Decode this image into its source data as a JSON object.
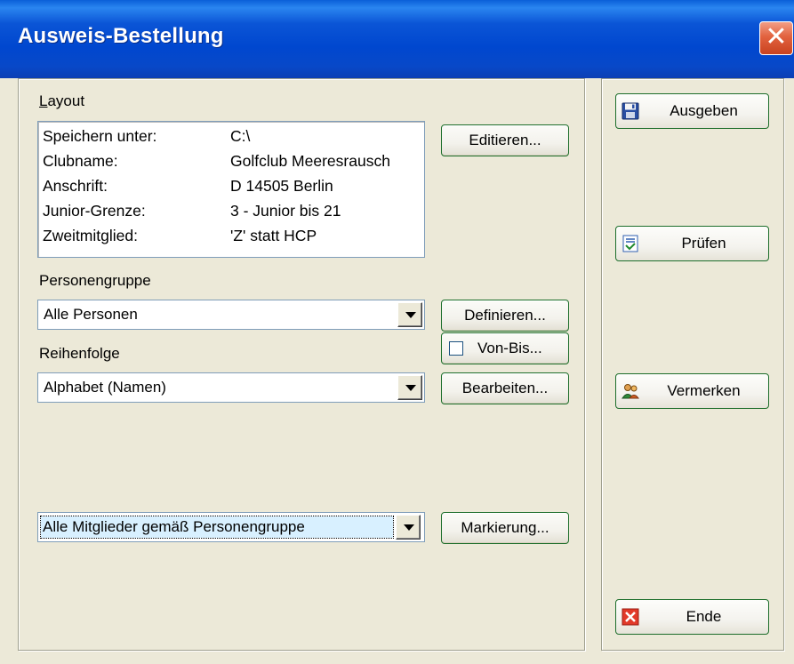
{
  "window": {
    "title": "Ausweis-Bestellung",
    "close_label": "✕"
  },
  "layout": {
    "group_label": "Layout",
    "rows": [
      {
        "key": "Speichern unter:",
        "value": "C:\\"
      },
      {
        "key": "Clubname:",
        "value": "Golfclub Meeresrausch"
      },
      {
        "key": "Anschrift:",
        "value": "D 14505 Berlin"
      },
      {
        "key": "Junior-Grenze:",
        "value": "3 - Junior bis 21"
      },
      {
        "key": "Zweitmitglied:",
        "value": "'Z' statt HCP"
      }
    ],
    "edit_button": "Editieren..."
  },
  "personengruppe": {
    "label": "Personengruppe",
    "selected": "Alle Personen",
    "define_button": "Definieren...",
    "vonbis_label": "Von-Bis...",
    "vonbis_checked": false
  },
  "reihenfolge": {
    "label": "Reihenfolge",
    "selected": "Alphabet (Namen)",
    "edit_button": "Bearbeiten..."
  },
  "markierung": {
    "selected": "Alle Mitglieder gemäß Personengruppe",
    "button": "Markierung..."
  },
  "actions": {
    "ausgeben": "Ausgeben",
    "pruefen": "Prüfen",
    "vermerken": "Vermerken",
    "ende": "Ende"
  },
  "icons": {
    "ausgeben": "floppy-disk-icon",
    "pruefen": "checklist-icon",
    "vermerken": "people-icon",
    "ende": "red-x-icon"
  }
}
